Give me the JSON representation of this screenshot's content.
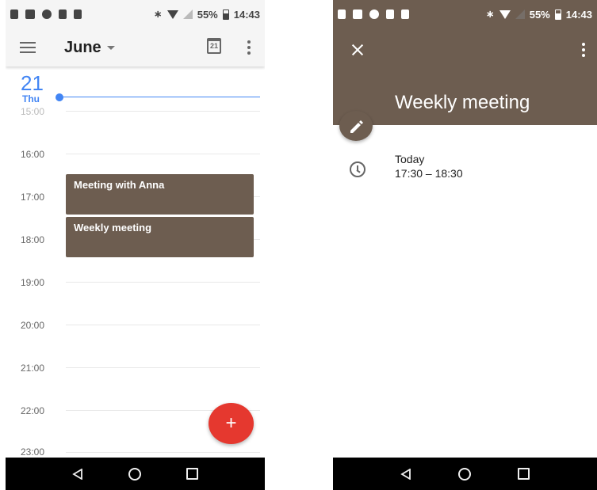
{
  "status_bar": {
    "battery": "55%",
    "time": "14:43"
  },
  "calendar": {
    "month": "June",
    "today_date_icon": "21",
    "day_number": "21",
    "day_name": "Thu",
    "hours": [
      {
        "label": "15:00",
        "partial": true
      },
      {
        "label": "16:00"
      },
      {
        "label": "17:00"
      },
      {
        "label": "18:00"
      },
      {
        "label": "19:00"
      },
      {
        "label": "20:00"
      },
      {
        "label": "21:00"
      },
      {
        "label": "22:00"
      },
      {
        "label": "23:00",
        "partial": true
      }
    ],
    "events": [
      {
        "title": "Meeting with Anna"
      },
      {
        "title": "Weekly meeting"
      }
    ],
    "fab_label": "+"
  },
  "event_detail": {
    "title": "Weekly meeting",
    "day": "Today",
    "time_range": "17:30 – 18:30"
  },
  "colors": {
    "event": "#6d5d50",
    "accent_blue": "#4285f4",
    "fab_red": "#e5382f"
  },
  "icons": [
    "upload-icon",
    "image-icon",
    "chat-icon",
    "sim-icon",
    "sd-card-icon",
    "bluetooth-icon",
    "wifi-icon",
    "signal-icon",
    "battery-icon",
    "menu-icon",
    "calendar-today-icon",
    "more-icon",
    "add-icon",
    "close-icon",
    "edit-icon",
    "clock-icon",
    "back-icon",
    "home-icon",
    "recents-icon"
  ]
}
